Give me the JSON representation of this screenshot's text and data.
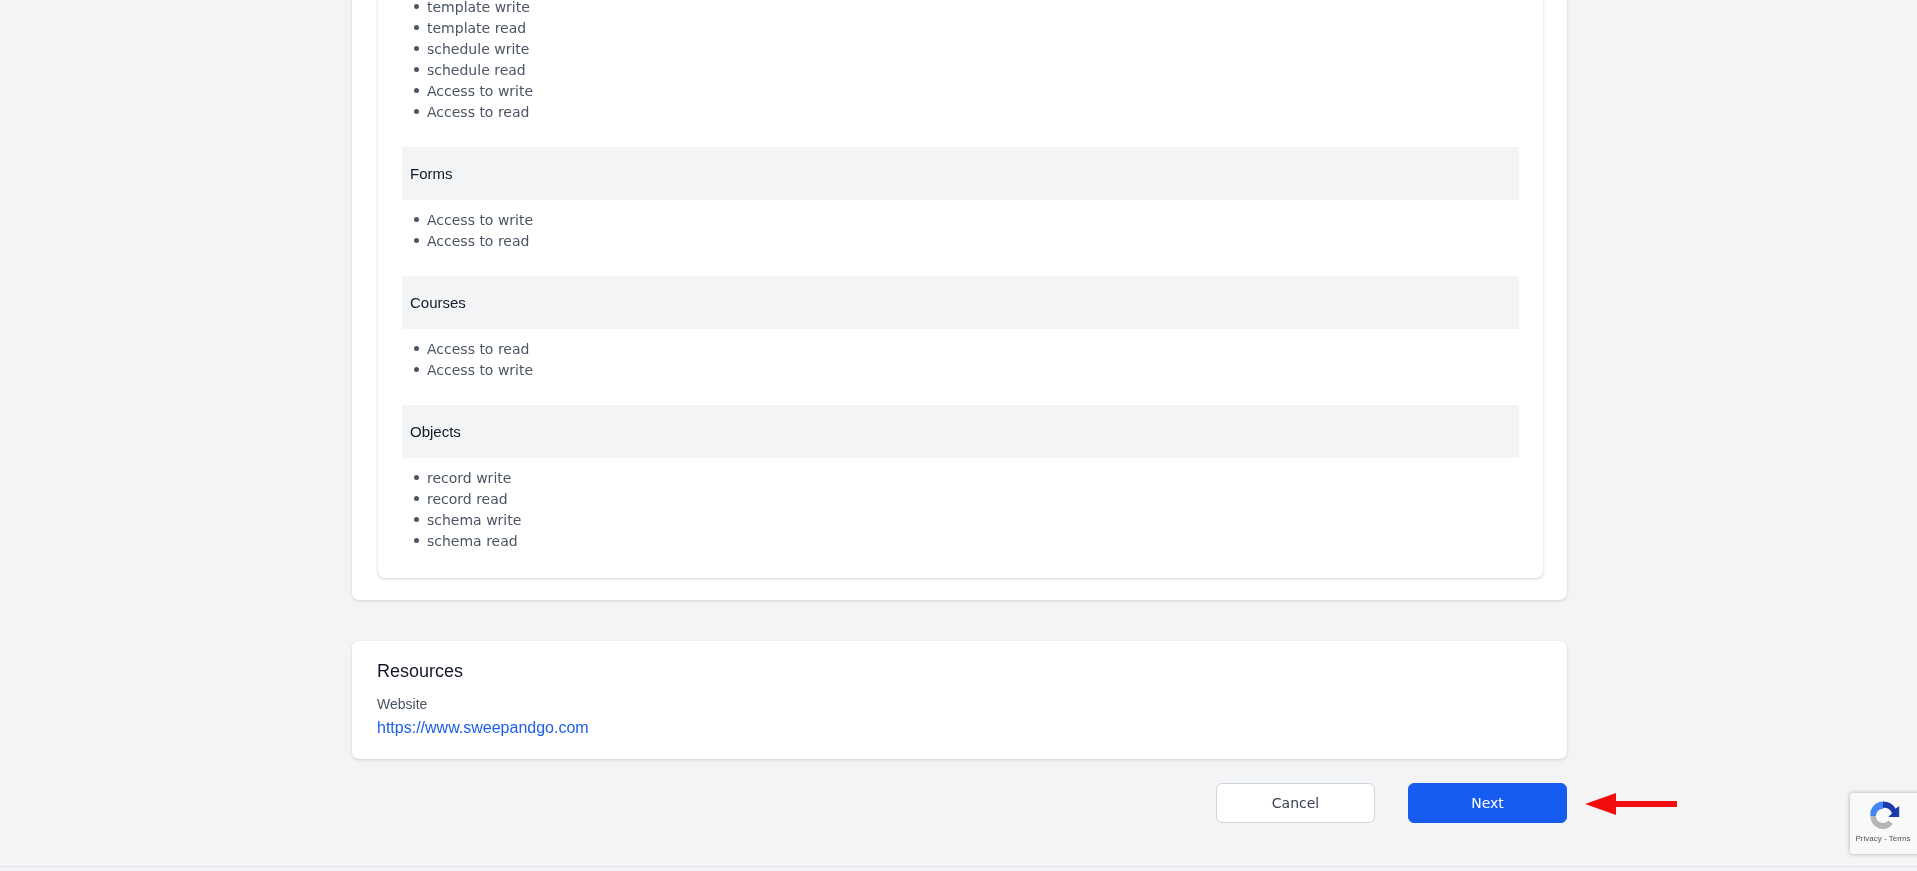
{
  "permission_groups": [
    {
      "items": [
        "template write",
        "template read",
        "schedule write",
        "schedule read",
        "Access to write",
        "Access to read"
      ]
    },
    {
      "title": "Forms",
      "items": [
        "Access to write",
        "Access to read"
      ]
    },
    {
      "title": "Courses",
      "items": [
        "Access to read",
        "Access to write"
      ]
    },
    {
      "title": "Objects",
      "items": [
        "record write",
        "record read",
        "schema write",
        "schema read"
      ]
    }
  ],
  "resources": {
    "title": "Resources",
    "label": "Website",
    "link": "https://www.sweepandgo.com"
  },
  "buttons": [
    {
      "label": "Cancel",
      "kind": "secondary"
    },
    {
      "label": "Next",
      "kind": "primary"
    }
  ],
  "recaptcha": {
    "text": "Privacy - Terms"
  }
}
